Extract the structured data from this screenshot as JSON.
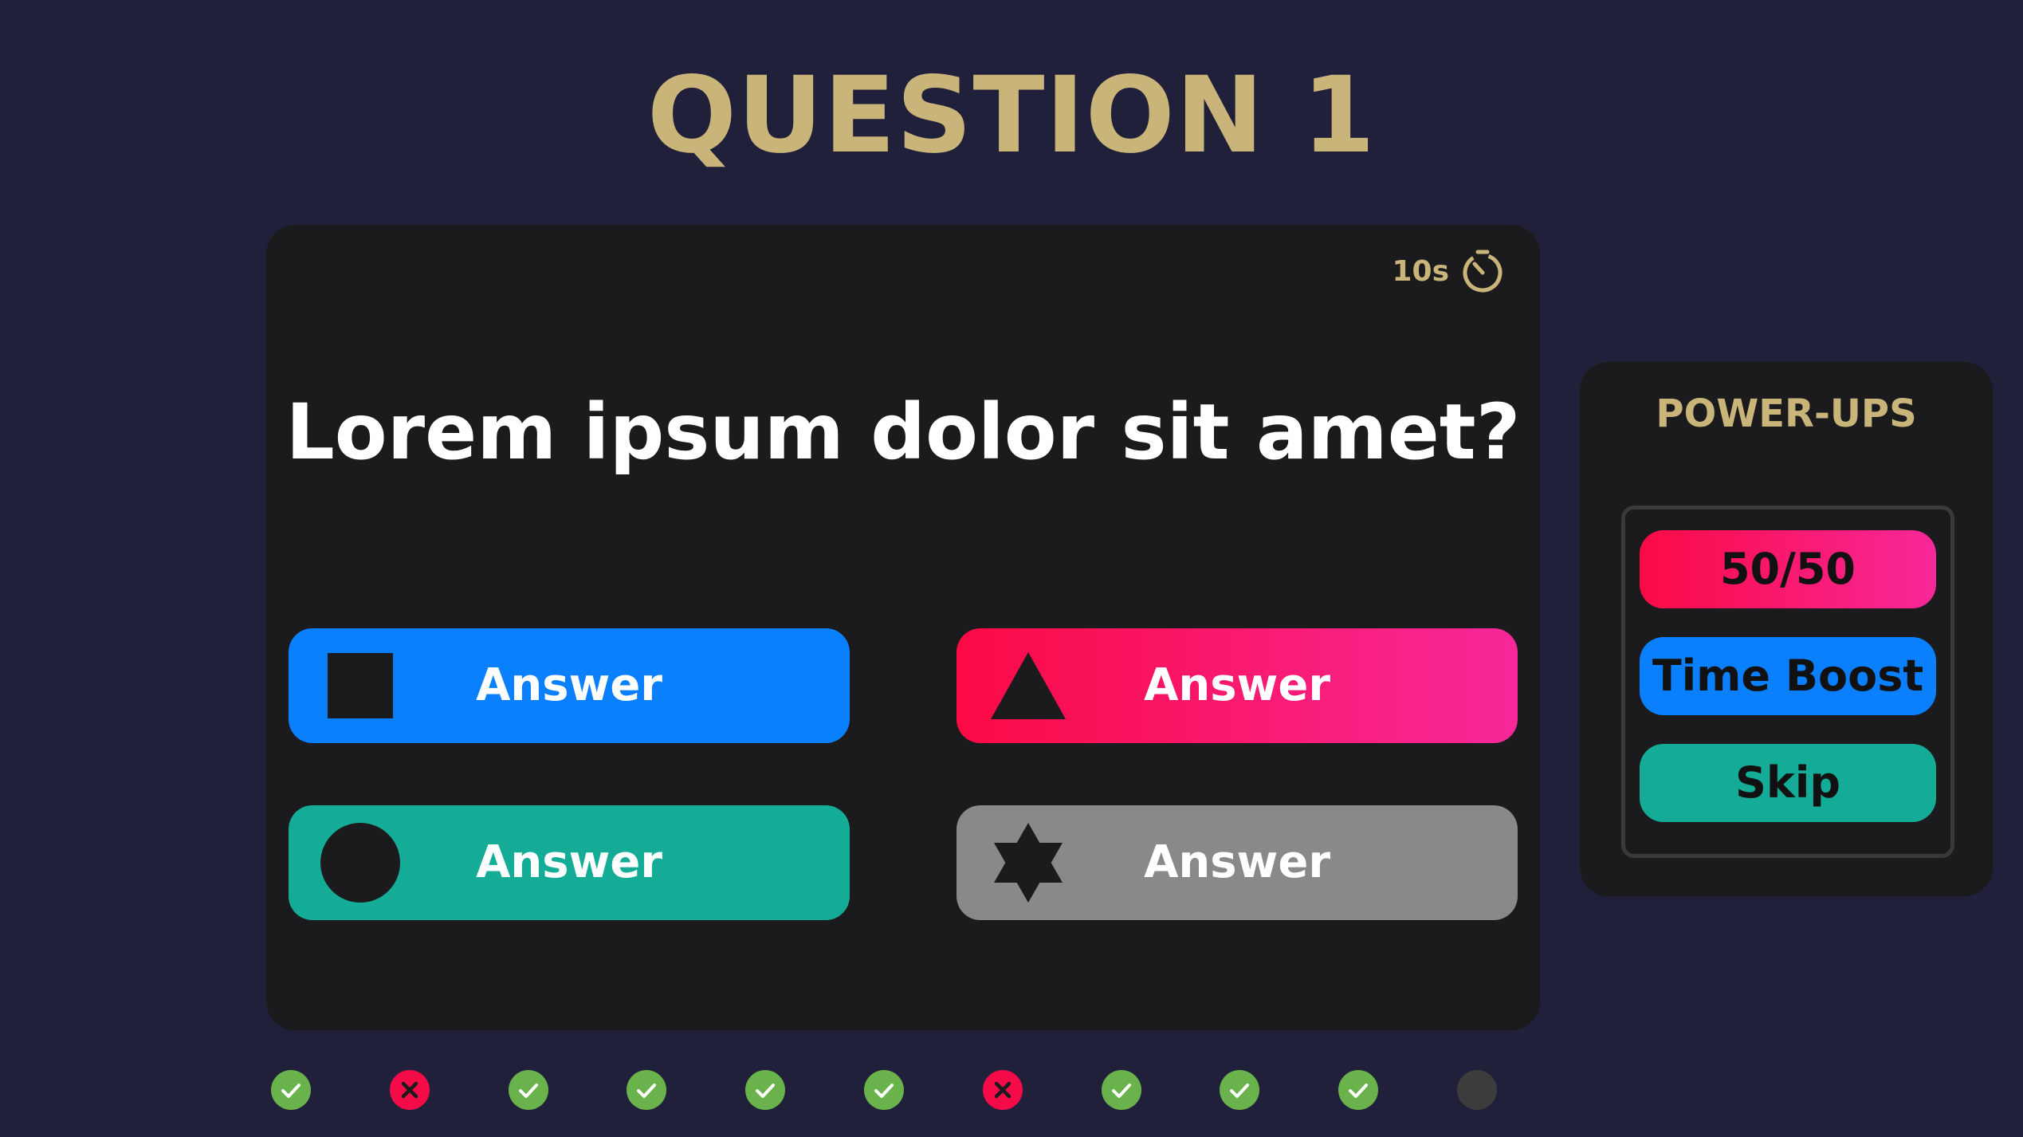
{
  "header": {
    "title": "QUESTION 1"
  },
  "timer": {
    "text": "10s",
    "icon": "stopwatch-icon"
  },
  "question": {
    "text": "Lorem ipsum dolor sit amet?"
  },
  "answers": [
    {
      "label": "Answer",
      "shape": "square-icon",
      "color": "#0a80fe"
    },
    {
      "label": "Answer",
      "shape": "triangle-icon",
      "color": "#fb0a44"
    },
    {
      "label": "Answer",
      "shape": "circle-icon",
      "color": "#15ac97"
    },
    {
      "label": "Answer",
      "shape": "star-icon",
      "color": "#898989"
    }
  ],
  "powerups": {
    "title": "POWER-UPS",
    "items": [
      {
        "label": "50/50"
      },
      {
        "label": "Time Boost"
      },
      {
        "label": "Skip"
      }
    ]
  },
  "progress": [
    "correct",
    "wrong",
    "correct",
    "correct",
    "correct",
    "correct",
    "wrong",
    "correct",
    "correct",
    "correct",
    "pending"
  ],
  "colors": {
    "background": "#21203a",
    "card": "#1b1b1d",
    "gold": "#c9b57a",
    "correct": "#6ab24b",
    "wrong": "#f50b47",
    "pending": "#3c3c3c"
  }
}
